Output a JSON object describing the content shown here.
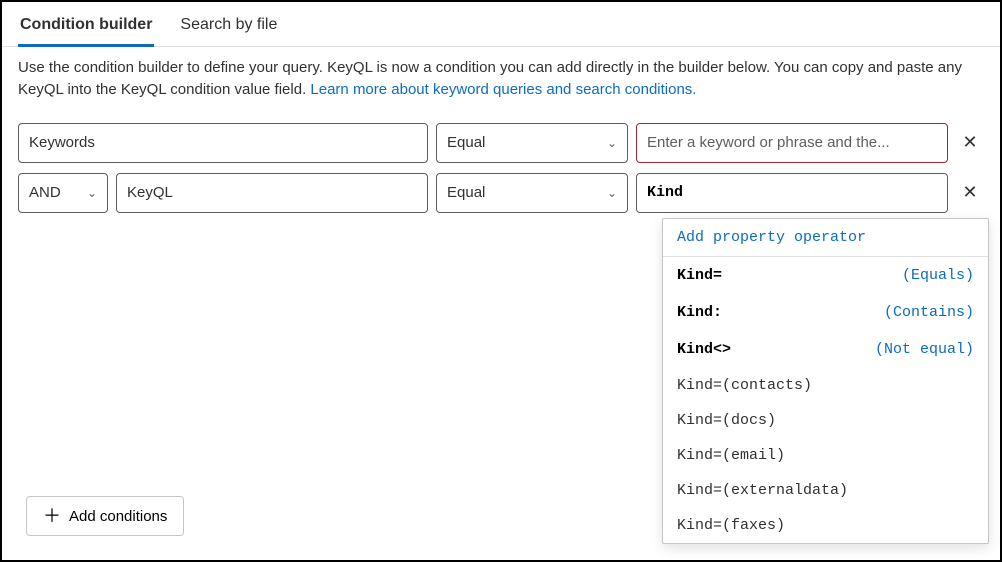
{
  "tabs": {
    "condition_builder": "Condition builder",
    "search_by_file": "Search by file"
  },
  "description": {
    "text": "Use the condition builder to define your query. KeyQL is now a condition you can add directly in the builder below. You can copy and paste any KeyQL into the KeyQL condition value field. ",
    "link": "Learn more about keyword queries and search conditions."
  },
  "rows": [
    {
      "condition": "Keywords",
      "operator": "Equal",
      "value_placeholder": "Enter a keyword or phrase and the..."
    },
    {
      "logic": "AND",
      "condition": "KeyQL",
      "operator": "Equal",
      "value": "Kind"
    }
  ],
  "add_conditions_label": "Add conditions",
  "suggestions": {
    "header": "Add property operator",
    "operators": [
      {
        "prop": "Kind=",
        "desc": "(Equals)"
      },
      {
        "prop": "Kind:",
        "desc": "(Contains)"
      },
      {
        "prop": "Kind<>",
        "desc": "(Not equal)"
      }
    ],
    "values": [
      "Kind=(contacts)",
      "Kind=(docs)",
      "Kind=(email)",
      "Kind=(externaldata)",
      "Kind=(faxes)"
    ]
  }
}
